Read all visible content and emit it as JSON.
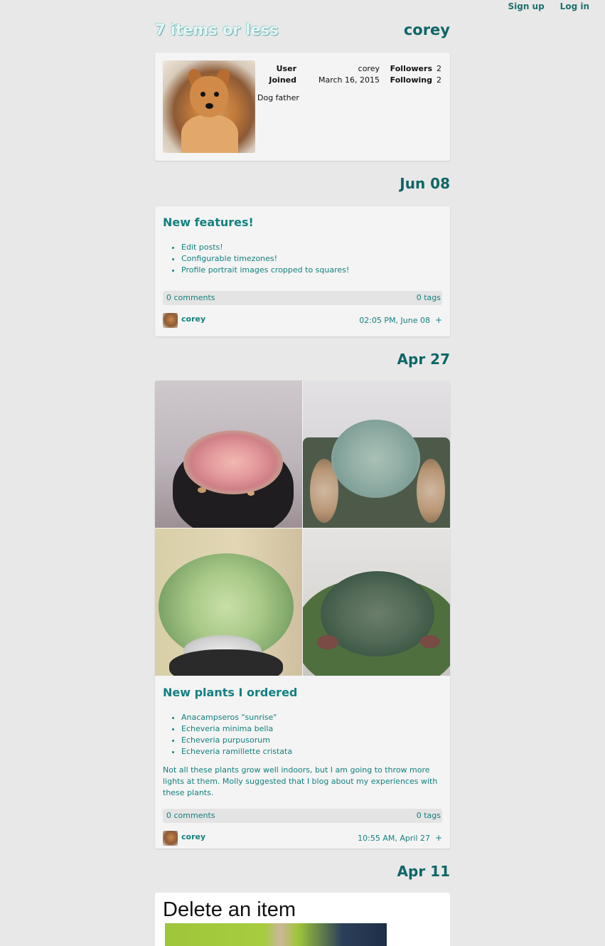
{
  "nav": {
    "signup": "Sign up",
    "login": "Log in"
  },
  "header": {
    "site_title": "7 items or less",
    "user": "corey"
  },
  "profile": {
    "user_label": "User",
    "user_value": "corey",
    "joined_label": "Joined",
    "joined_value": "March 16, 2015",
    "followers_label": "Followers",
    "followers_value": "2",
    "following_label": "Following",
    "following_value": "2",
    "bio": "Dog father"
  },
  "posts": [
    {
      "date": "Jun 08",
      "title": "New features!",
      "items": [
        "Edit posts!",
        "Configurable timezones!",
        "Profile portrait images cropped to squares!"
      ],
      "paragraph": "",
      "comments": "0 comments",
      "tags": "0 tags",
      "author": "corey",
      "time": "02:05 PM, June 08",
      "action": "+"
    },
    {
      "date": "Apr 27",
      "title": "New plants I ordered",
      "items": [
        "Anacampseros \"sunrise\"",
        "Echeveria minima bella",
        "Echeveria purpusorum",
        "Echeveria ramillette cristata"
      ],
      "paragraph": "Not all these plants grow well indoors, but I am going to throw more lights at them. Molly suggested that I blog about my experiences with these plants.",
      "comments": "0 comments",
      "tags": "0 tags",
      "author": "corey",
      "time": "10:55 AM, April 27",
      "action": "+"
    }
  ],
  "third_post": {
    "date": "Apr 11",
    "title": "Delete an item"
  }
}
